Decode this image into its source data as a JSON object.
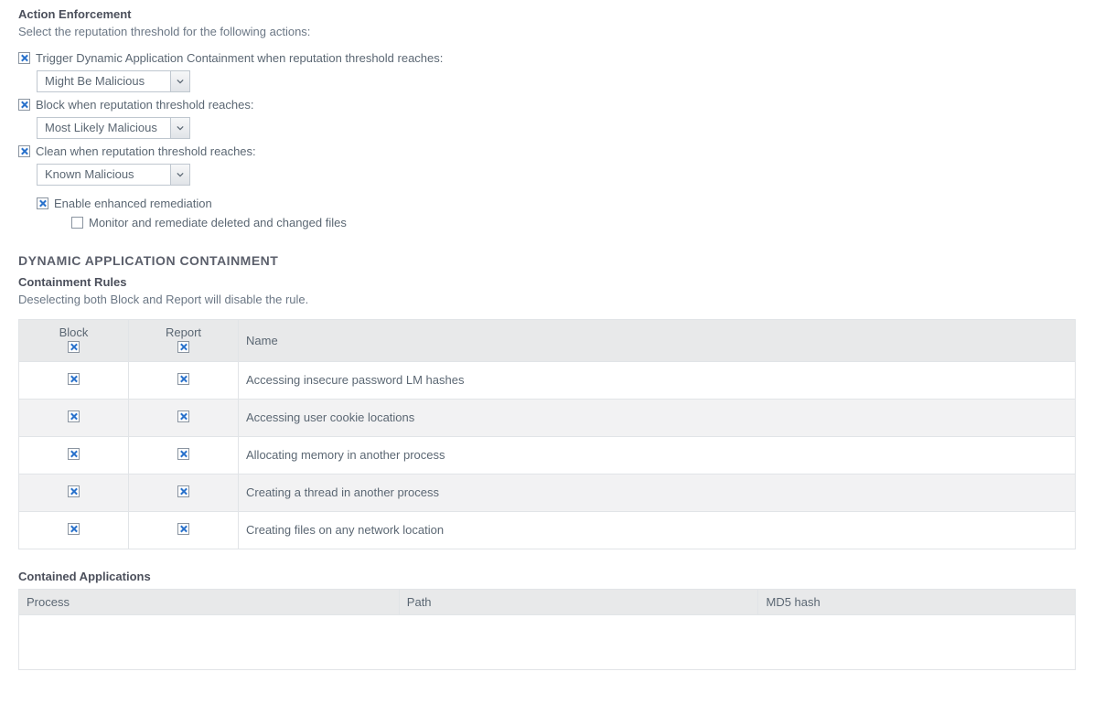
{
  "actionEnforcement": {
    "title": "Action Enforcement",
    "hint": "Select the reputation threshold for the following actions:",
    "triggerDac": {
      "checked": true,
      "label": "Trigger Dynamic Application Containment when reputation threshold reaches:",
      "value": "Might Be Malicious"
    },
    "block": {
      "checked": true,
      "label": "Block when reputation threshold reaches:",
      "value": "Most Likely Malicious"
    },
    "clean": {
      "checked": true,
      "label": "Clean when reputation threshold reaches:",
      "value": "Known Malicious"
    },
    "enhanced": {
      "checked": true,
      "label": "Enable enhanced remediation"
    },
    "monitor": {
      "checked": false,
      "label": "Monitor and remediate deleted and changed files"
    }
  },
  "dac": {
    "title": "DYNAMIC APPLICATION CONTAINMENT",
    "rulesTitle": "Containment Rules",
    "rulesHint": "Deselecting both Block and Report will disable the rule.",
    "headers": {
      "block": "Block",
      "report": "Report",
      "name": "Name"
    },
    "headerChecks": {
      "block": true,
      "report": true
    },
    "rules": [
      {
        "block": true,
        "report": true,
        "name": "Accessing insecure password LM hashes"
      },
      {
        "block": true,
        "report": true,
        "name": "Accessing user cookie locations"
      },
      {
        "block": true,
        "report": true,
        "name": "Allocating memory in another process"
      },
      {
        "block": true,
        "report": true,
        "name": "Creating a thread in another process"
      },
      {
        "block": true,
        "report": true,
        "name": "Creating files on any network location"
      }
    ]
  },
  "containedApps": {
    "title": "Contained Applications",
    "headers": {
      "process": "Process",
      "path": "Path",
      "md5": "MD5 hash"
    },
    "rows": []
  }
}
